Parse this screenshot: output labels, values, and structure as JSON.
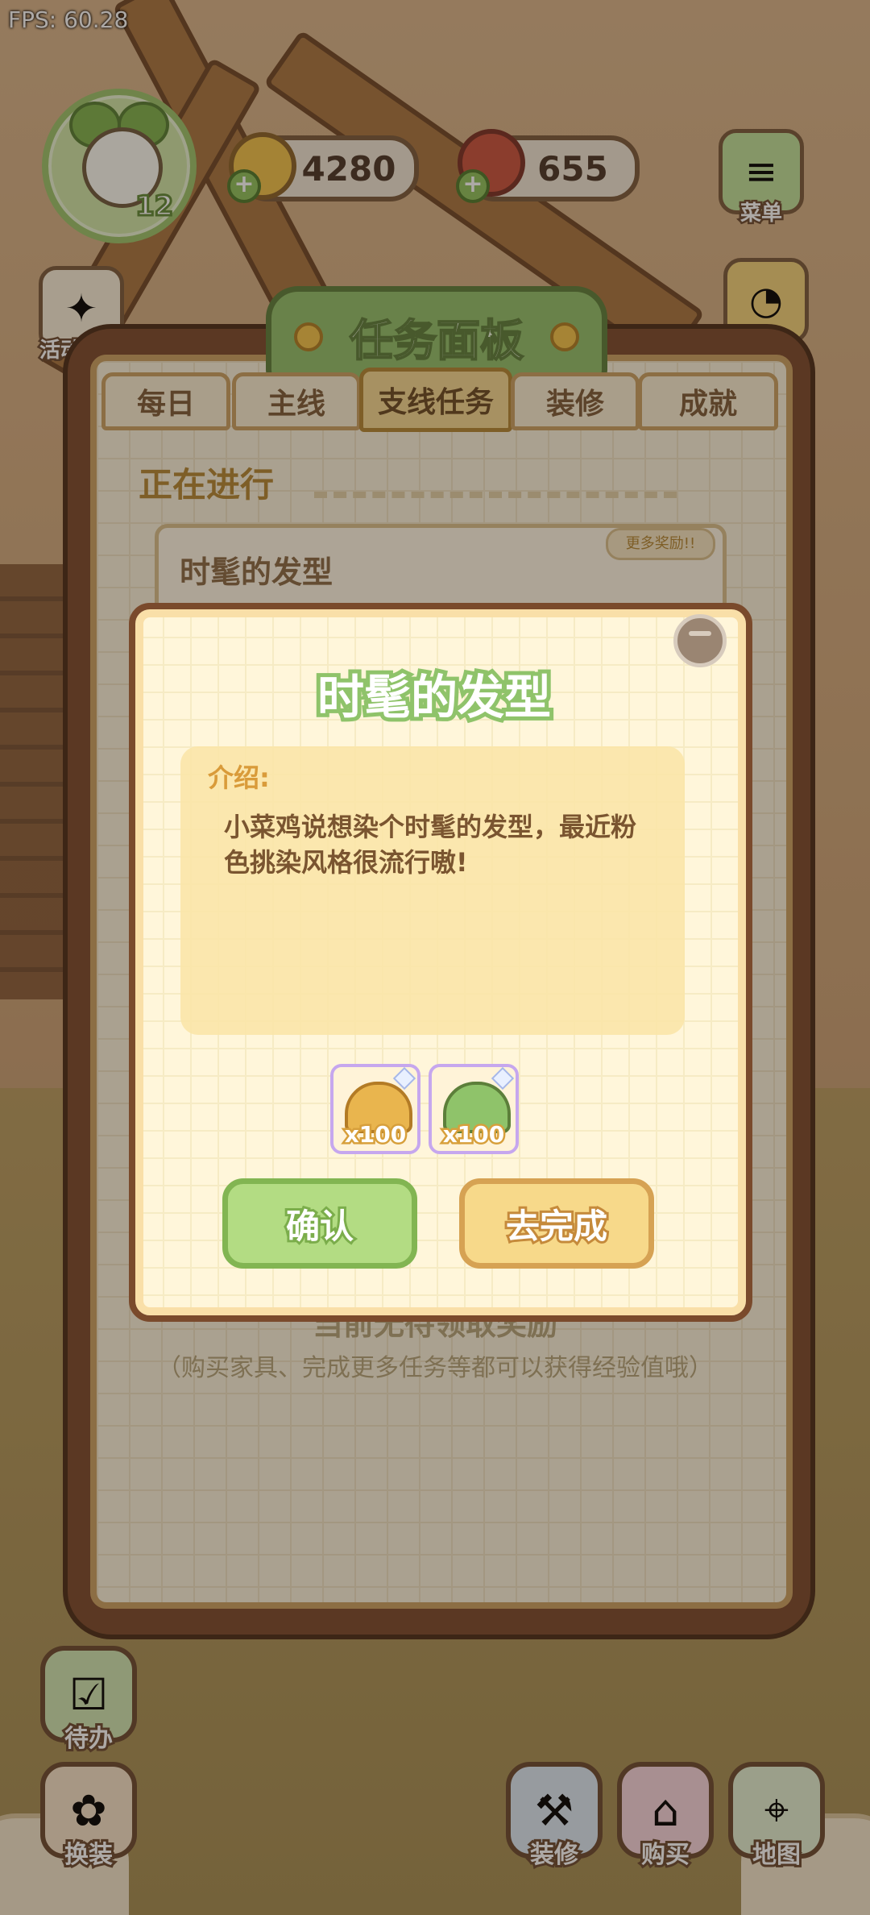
{
  "hud": {
    "fps": "FPS: 60.28",
    "level": "12",
    "coins": "4280",
    "meat": "655"
  },
  "side_left": [
    {
      "label": "活动汇总",
      "icon": "activity-icon"
    }
  ],
  "side_right": [
    {
      "label": "菜单",
      "icon": "menu-icon"
    }
  ],
  "panel": {
    "title": "任务面板",
    "tabs": [
      "每日",
      "主线",
      "支线任务",
      "装修",
      "成就"
    ],
    "active_tab": "支线任务",
    "section": "正在进行",
    "task_name": "时髦的发型",
    "more_rewards": "更多奖励!!",
    "no_reward": "当前无待领取奖励",
    "tip": "（购买家具、完成更多任务等都可以获得经验值哦）"
  },
  "dialog": {
    "title": "时髦的发型",
    "intro_label": "介绍:",
    "intro_text": "小菜鸡说想染个时髦的发型，最近粉色挑染风格很流行嗷!",
    "rewards": [
      {
        "qty": "x100",
        "icon": "coin-pile-icon",
        "color": "#e9b54e"
      },
      {
        "qty": "x100",
        "icon": "green-upgrade-icon",
        "color": "#8fc36a"
      }
    ],
    "confirm": "确认",
    "go_complete": "去完成"
  },
  "bottom_nav": {
    "todo": "待办",
    "dress": "换装",
    "decorate": "装修",
    "buy": "购买",
    "map": "地图"
  },
  "colors": {
    "panel_wood": "#7b4a2c",
    "title_green": "#8fc36a",
    "accent_gold": "#d99b3a"
  }
}
